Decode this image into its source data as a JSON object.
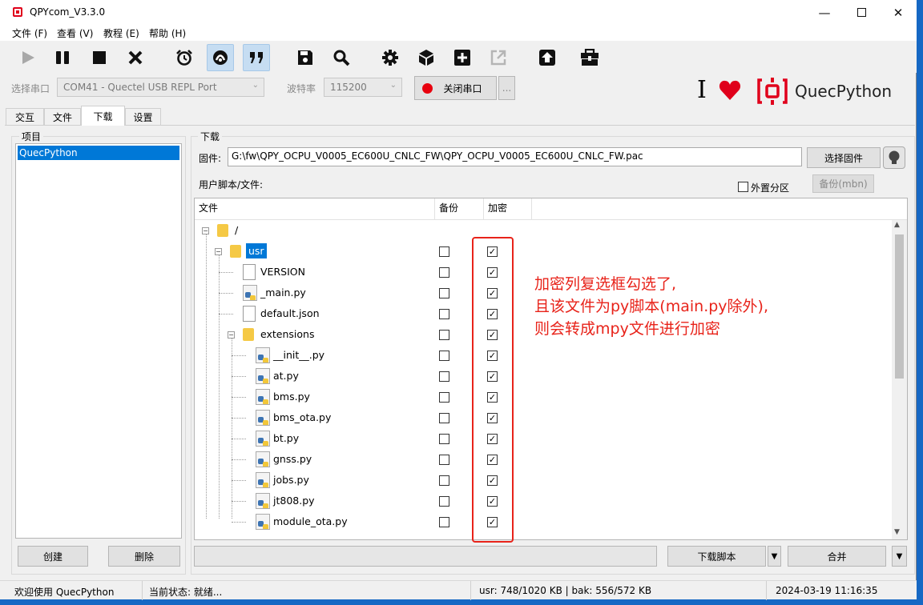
{
  "window": {
    "title": "QPYcom_V3.3.0"
  },
  "menu": [
    "文件 (F)",
    "查看 (V)",
    "教程 (E)",
    "帮助 (H)"
  ],
  "toolbar": {
    "icons": [
      "run-icon",
      "pause-icon",
      "stop-icon",
      "close-icon",
      "alarm-clock-icon",
      "gateway-icon",
      "quote-icon",
      "save-icon",
      "search-icon",
      "gear-icon",
      "package-icon",
      "add-icon",
      "export-icon",
      "upload-icon",
      "toolbox-icon"
    ]
  },
  "serial": {
    "port_label": "选择串口",
    "port_value": "COM41 - Quectel USB REPL Port",
    "baud_label": "波特率",
    "baud_value": "115200",
    "close_port_label": "关闭串口",
    "more_label": "..."
  },
  "brand": {
    "cursor": "I",
    "name": "QuecPython"
  },
  "tabs": [
    "交互",
    "文件",
    "下载",
    "设置"
  ],
  "project": {
    "group_title": "项目",
    "items": [
      "QuecPython"
    ],
    "create_label": "创建",
    "delete_label": "删除"
  },
  "download": {
    "group_title": "下载",
    "firmware_label": "固件:",
    "firmware_path": "G:\\fw\\QPY_OCPU_V0005_EC600U_CNLC_FW\\QPY_OCPU_V0005_EC600U_CNLC_FW.pac",
    "select_firmware_label": "选择固件",
    "user_scripts_label": "用户脚本/文件:",
    "external_partition_label": "外置分区",
    "backup_mbn_label": "备份(mbn)",
    "columns": [
      "文件",
      "备份",
      "加密"
    ],
    "tree": [
      {
        "name": "/",
        "type": "folder",
        "level": 0,
        "expand": "−"
      },
      {
        "name": "usr",
        "type": "folder",
        "level": 1,
        "expand": "−",
        "selected": true,
        "backup": false,
        "encrypt": true
      },
      {
        "name": "VERSION",
        "type": "file",
        "level": 2,
        "backup": false,
        "encrypt": true
      },
      {
        "name": "_main.py",
        "type": "py",
        "level": 2,
        "backup": false,
        "encrypt": true
      },
      {
        "name": "default.json",
        "type": "file",
        "level": 2,
        "backup": false,
        "encrypt": true
      },
      {
        "name": "extensions",
        "type": "folder",
        "level": 2,
        "expand": "−",
        "backup": false,
        "encrypt": true
      },
      {
        "name": "__init__.py",
        "type": "py",
        "level": 3,
        "backup": false,
        "encrypt": true
      },
      {
        "name": "at.py",
        "type": "py",
        "level": 3,
        "backup": false,
        "encrypt": true
      },
      {
        "name": "bms.py",
        "type": "py",
        "level": 3,
        "backup": false,
        "encrypt": true
      },
      {
        "name": "bms_ota.py",
        "type": "py",
        "level": 3,
        "backup": false,
        "encrypt": true
      },
      {
        "name": "bt.py",
        "type": "py",
        "level": 3,
        "backup": false,
        "encrypt": true
      },
      {
        "name": "gnss.py",
        "type": "py",
        "level": 3,
        "backup": false,
        "encrypt": true
      },
      {
        "name": "jobs.py",
        "type": "py",
        "level": 3,
        "backup": false,
        "encrypt": true
      },
      {
        "name": "jt808.py",
        "type": "py",
        "level": 3,
        "backup": false,
        "encrypt": true
      },
      {
        "name": "module_ota.py",
        "type": "py",
        "level": 3,
        "backup": false,
        "encrypt": true
      }
    ],
    "annotation": [
      "加密列复选框勾选了,",
      "且该文件为py脚本(main.py除外),",
      "则会转成mpy文件进行加密"
    ],
    "download_script_label": "下载脚本",
    "merge_label": "合并"
  },
  "status": {
    "welcome": "欢迎使用 QuecPython",
    "state": "当前状态: 就绪...",
    "storage": "usr: 748/1020 KB | bak: 556/572 KB",
    "datetime": "2024-03-19 11:16:35"
  },
  "colors": {
    "accent": "#e0001b",
    "selection": "#0078d7",
    "annotation": "#e8231a"
  }
}
